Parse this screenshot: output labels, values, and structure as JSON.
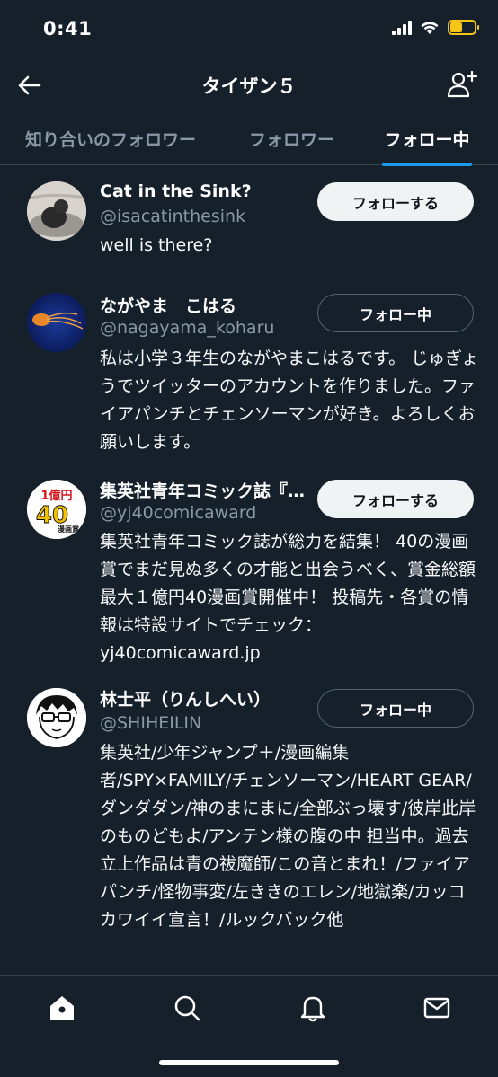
{
  "status": {
    "time": "0:41",
    "battery_level": 0.5,
    "battery_color": "#f5c518"
  },
  "header": {
    "title": "タイザン５",
    "back_icon": "arrow-left-icon",
    "add_user_icon": "person-add-icon"
  },
  "tabs": [
    {
      "label": "知り合いのフォロワー",
      "active": false
    },
    {
      "label": "フォロワー",
      "active": false
    },
    {
      "label": "フォロー中",
      "active": true
    }
  ],
  "users": [
    {
      "name": "Cat in the Sink?",
      "handle": "@isacatinthesink",
      "bio": "well is there?",
      "button": "フォローする",
      "following": false
    },
    {
      "name": "ながやま　こはる",
      "handle": "@nagayama_koharu",
      "bio": "私は小学３年生のながやまこはるです。 じゅぎょうでツイッターのアカウントを作りました。ファイアパンチとチェンソーマンが好き。よろしくお願いします。",
      "button": "フォロー中",
      "following": true
    },
    {
      "name": "集英社青年コミック誌『…",
      "handle": "@yj40comicaward",
      "bio": "集英社青年コミック誌が総力を結集！ 40の漫画賞でまだ見ぬ多くの才能と出会うべく、賞金総額最大１億円40漫画賞開催中！ 投稿先・各賞の情報は特設サイトでチェック：yj40comicaward.jp",
      "button": "フォローする",
      "following": false,
      "avatar_text_top": "1億円",
      "avatar_text_mid": "40",
      "avatar_text_bottom": "漫画賞"
    },
    {
      "name": "林士平（りんしへい）",
      "handle": "@SHIHEILIN",
      "bio": "集英社/少年ジャンプ＋/漫画編集者/SPY×FAMILY/チェンソーマン/HEART GEAR/ダンダダン/神のまにまに/全部ぶっ壊す/彼岸此岸のものどもよ/アンテン様の腹の中 担当中。過去立上作品は青の祓魔師/この音とまれ！/ファイアパンチ/怪物事変/左ききのエレン/地獄楽/カッコカワイイ宣言！/ルックバック他",
      "button": "フォロー中",
      "following": true
    }
  ],
  "nav": [
    "home-icon",
    "search-icon",
    "bell-icon",
    "mail-icon"
  ],
  "colors": {
    "background": "#15202b",
    "accent": "#1d9bf0",
    "secondary_text": "#8b98a5",
    "divider": "#38444d"
  }
}
